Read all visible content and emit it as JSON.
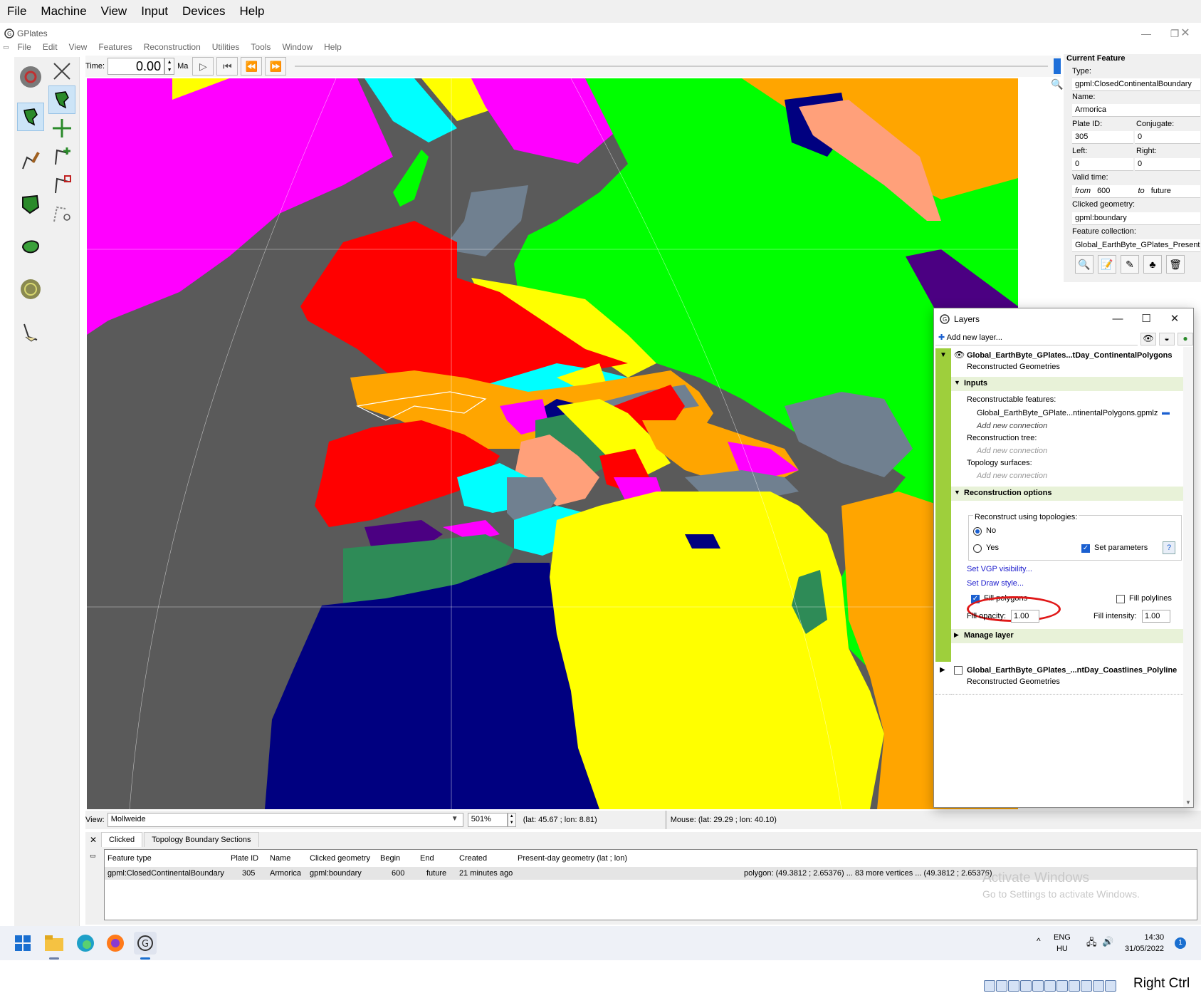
{
  "vm_menu": [
    "File",
    "Machine",
    "View",
    "Input",
    "Devices",
    "Help"
  ],
  "app": {
    "title": "GPlates",
    "menu": [
      "File",
      "Edit",
      "View",
      "Features",
      "Reconstruction",
      "Utilities",
      "Tools",
      "Window",
      "Help"
    ]
  },
  "time_bar": {
    "label": "Time:",
    "value": "0.00",
    "unit": "Ma"
  },
  "map": {
    "colors": {
      "background": "#5a5a5a",
      "magenta": "#ff00ff",
      "green": "#00ff00",
      "red": "#ff0000",
      "orange": "#ffa500",
      "yellow": "#ffff00",
      "navy": "#000080",
      "cyan": "#00ffff",
      "slate": "#708090",
      "salmon": "#ffa07a",
      "seagreen": "#2e8b57",
      "indigo": "#4b0082"
    }
  },
  "view_bar": {
    "label": "View:",
    "projection": "Mollweide",
    "zoom": "501%",
    "centre": "(lat: 45.67 ; lon: 8.81)",
    "mouse": "Mouse: (lat: 29.29 ; lon: 40.10)"
  },
  "bottom_panel": {
    "tabs": [
      "Clicked",
      "Topology Boundary Sections"
    ],
    "columns": [
      "Feature type",
      "Plate ID",
      "Name",
      "Clicked geometry",
      "Begin",
      "End",
      "Created",
      "Present-day geometry (lat ; lon)"
    ],
    "row": {
      "feature_type": "gpml:ClosedContinentalBoundary",
      "plate_id": "305",
      "name": "Armorica",
      "clicked_geometry": "gpml:boundary",
      "begin": "600",
      "end": "future",
      "created": "21 minutes ago",
      "present_day_geometry": "polygon: (49.3812 ; 2.65376) ... 83 more vertices ... (49.3812 ; 2.65376)"
    }
  },
  "watermark": {
    "line1": "Activate Windows",
    "line2": "Go to Settings to activate Windows."
  },
  "current_feature": {
    "title": "Current Feature",
    "type_label": "Type:",
    "type": "gpml:ClosedContinentalBoundary",
    "name_label": "Name:",
    "name": "Armorica",
    "plate_id_label": "Plate ID:",
    "plate_id": "305",
    "conjugate_label": "Conjugate:",
    "conjugate": "0",
    "left_label": "Left:",
    "left": "0",
    "right_label": "Right:",
    "right": "0",
    "valid_time_label": "Valid time:",
    "from_label": "from",
    "from": "600",
    "to_label": "to",
    "to": "future",
    "clicked_geometry_label": "Clicked geometry:",
    "clicked_geometry": "gpml:boundary",
    "feature_collection_label": "Feature collection:",
    "feature_collection": "Global_EarthByte_GPlates_PresentD"
  },
  "layers_window": {
    "title": "Layers",
    "add_new_layer": "Add new layer...",
    "layer1": {
      "name": "Global_EarthByte_GPlates...tDay_ContinentalPolygons",
      "type": "Reconstructed Geometries",
      "inputs_header": "Inputs",
      "reconstructable_features_label": "Reconstructable features:",
      "reconstructable_file": "Global_EarthByte_GPlate...ntinentalPolygons.gpmlz",
      "add_new_connection": "Add new connection",
      "reconstruction_tree_label": "Reconstruction tree:",
      "topology_surfaces_label": "Topology surfaces:",
      "recon_options_header": "Reconstruction options",
      "reconstruct_using_topologies": "Reconstruct using topologies:",
      "no": "No",
      "yes": "Yes",
      "set_parameters": "Set parameters",
      "set_vgp_visibility": "Set VGP visibility...",
      "set_draw_style": "Set Draw style...",
      "fill_polygons": "Fill polygons",
      "fill_polylines": "Fill polylines",
      "fill_opacity_label": "Fill opacity:",
      "fill_opacity": "1.00",
      "fill_intensity_label": "Fill intensity:",
      "fill_intensity": "1.00",
      "manage_layer": "Manage layer"
    },
    "layer2": {
      "name": "Global_EarthByte_GPlates_...ntDay_Coastlines_Polyline",
      "type": "Reconstructed Geometries"
    },
    "strip_color": "#9ecf3c"
  },
  "taskbar": {
    "lang": "ENG",
    "keyboard": "HU",
    "time": "14:30",
    "date": "31/05/2022",
    "notifications": "1"
  },
  "vm_status": {
    "host_key": "Right Ctrl"
  }
}
